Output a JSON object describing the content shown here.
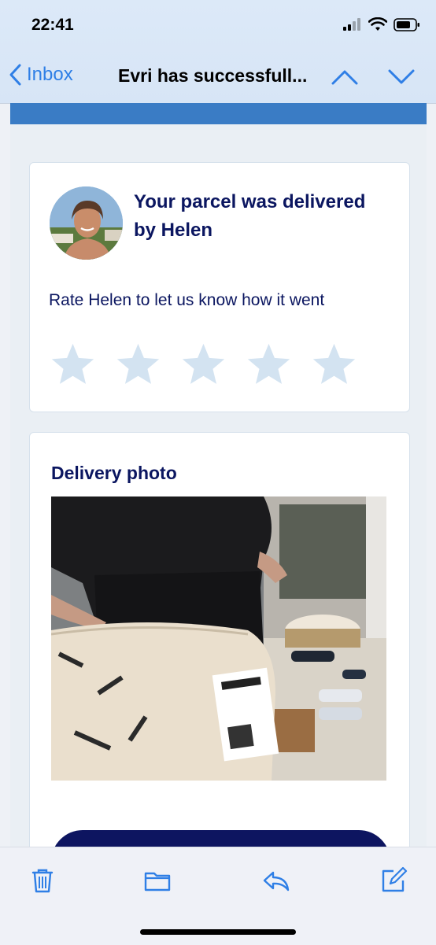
{
  "status_bar": {
    "time": "22:41"
  },
  "nav": {
    "back_label": "Inbox",
    "title": "Evri has successfull..."
  },
  "delivery_card": {
    "headline": "Your parcel was delivered by Helen",
    "rate_prompt": "Rate Helen to let us know how it went",
    "rating": {
      "value": 0,
      "max": 5
    }
  },
  "photo_card": {
    "title": "Delivery photo"
  },
  "colors": {
    "accent_blue": "#2f7fe6",
    "email_header_bar": "#3a7cc5",
    "heading_navy": "#0b1660",
    "star_empty": "#d3e3f1",
    "cta_navy": "#0d1560"
  },
  "toolbar": {
    "icons": [
      "trash-icon",
      "folder-icon",
      "reply-icon",
      "compose-icon"
    ]
  }
}
